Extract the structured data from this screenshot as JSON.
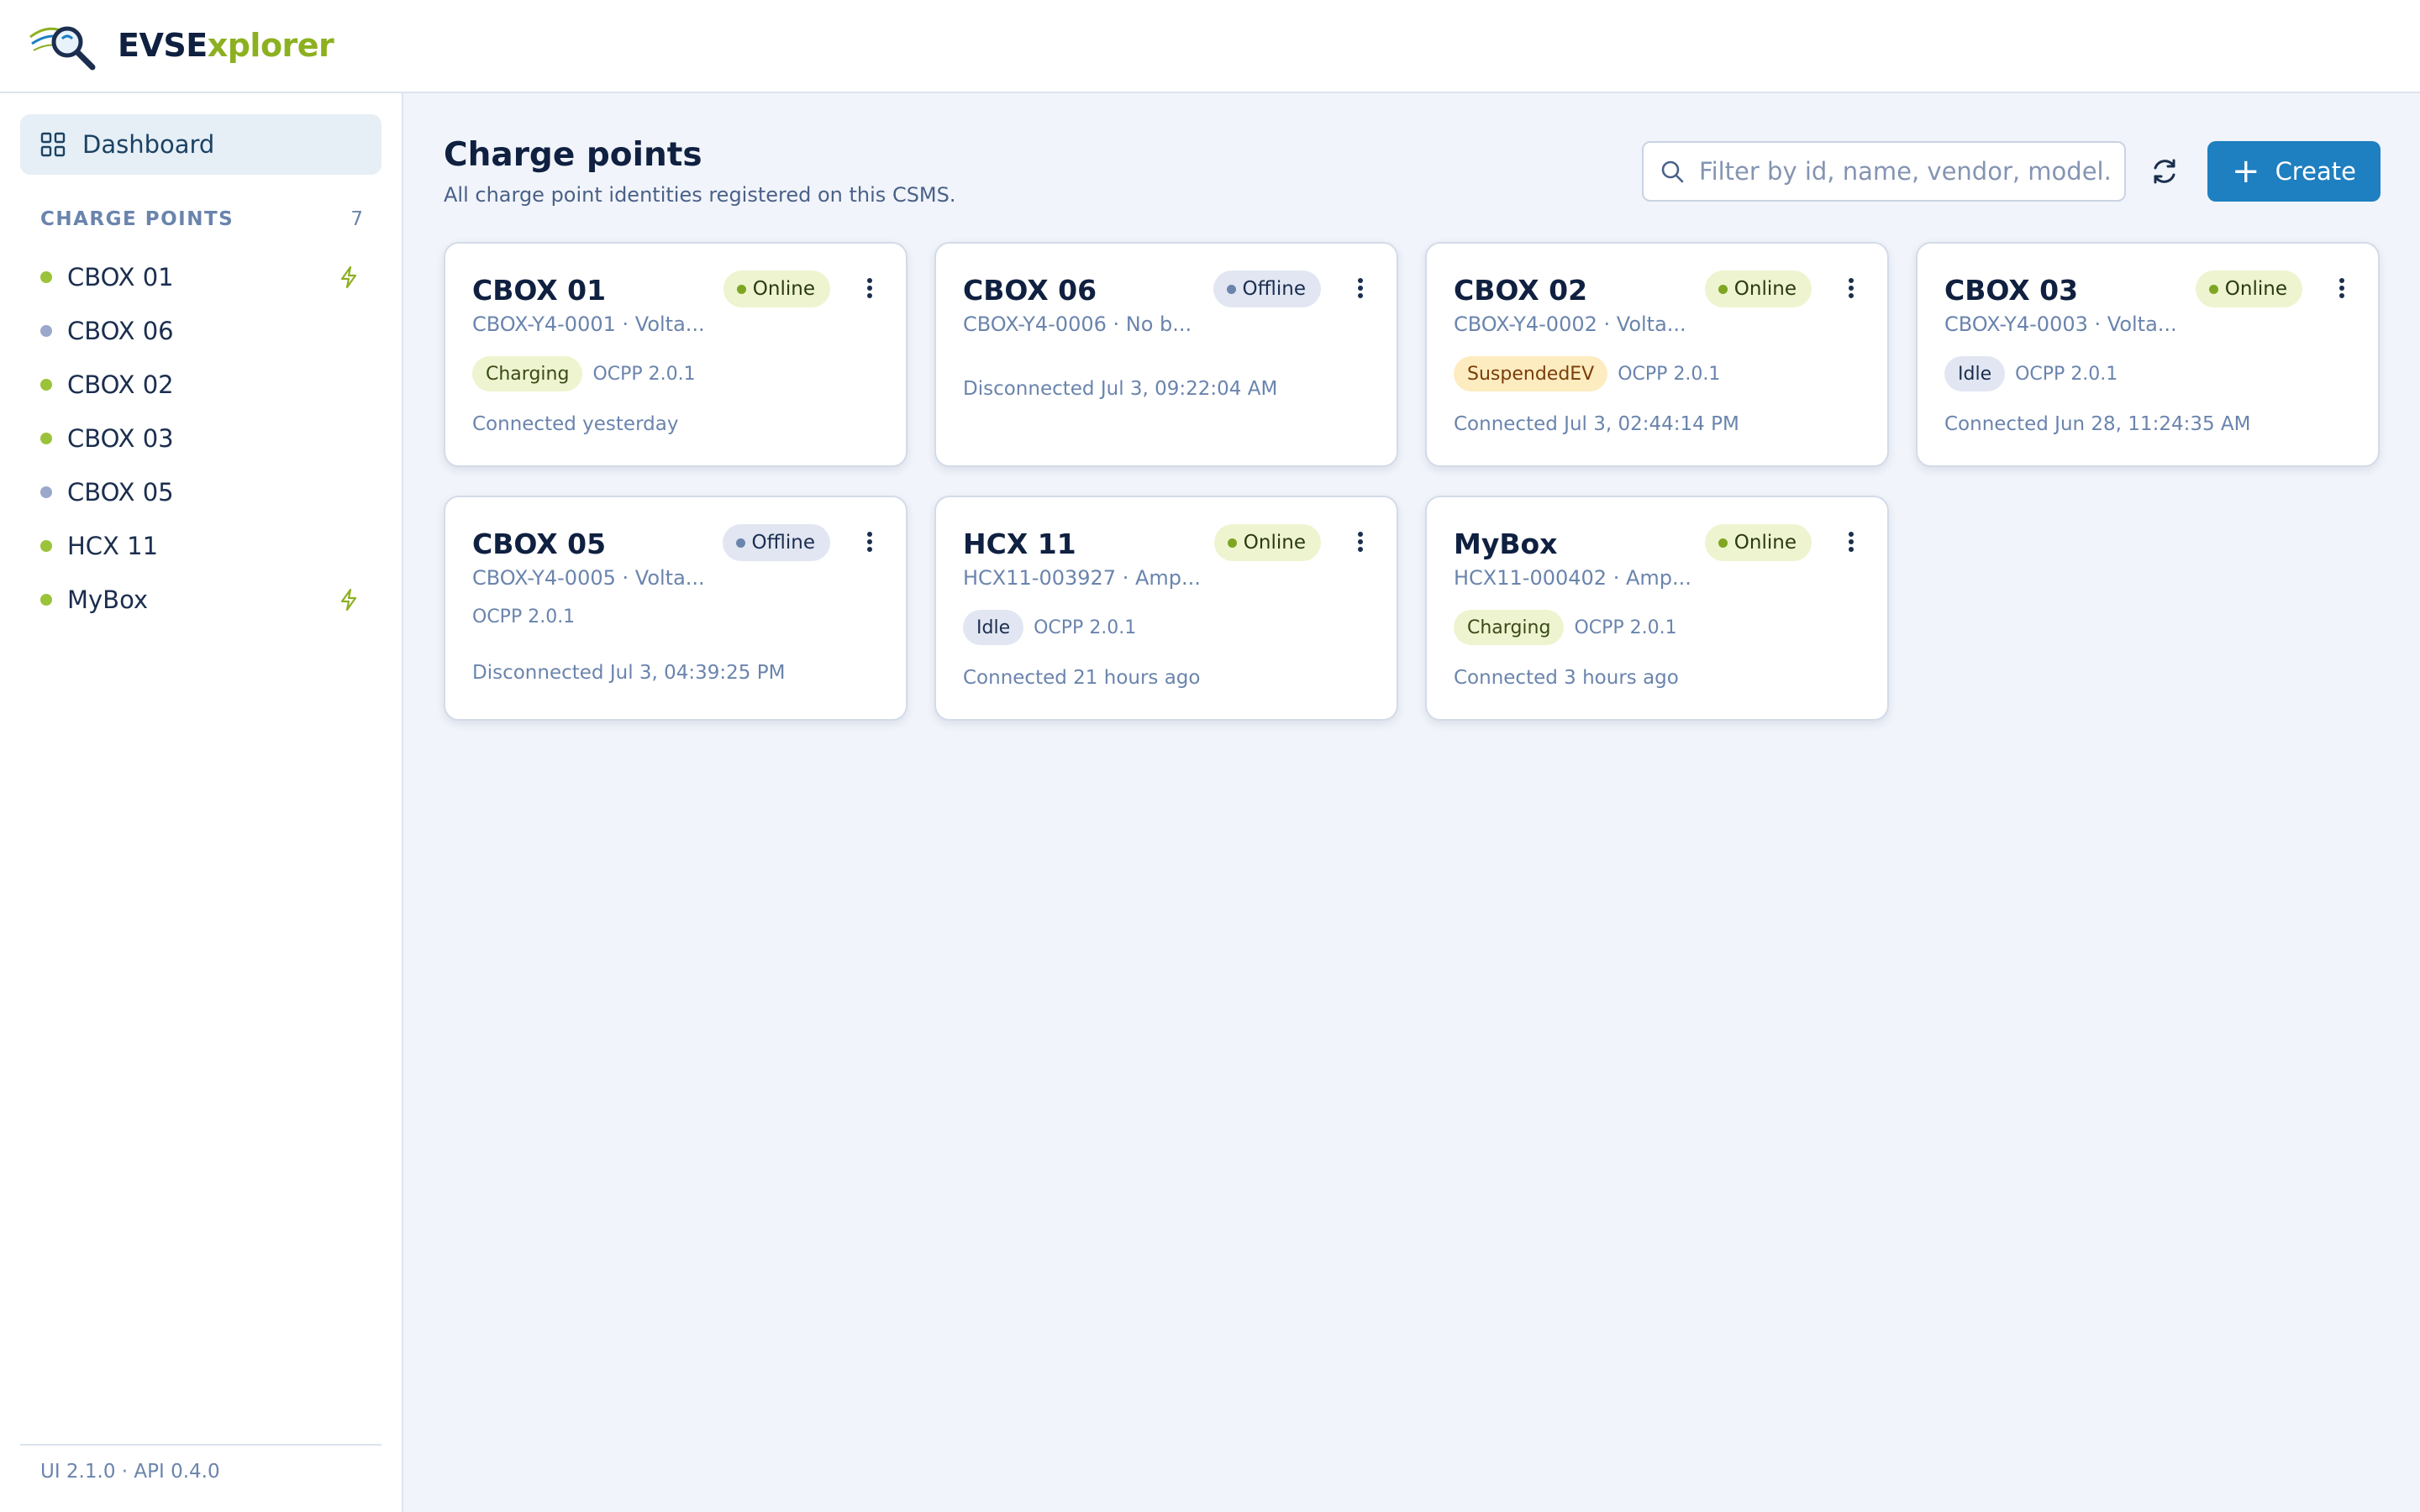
{
  "header": {
    "brand_prefix": "EVSE",
    "brand_suffix": "xplorer"
  },
  "sidebar": {
    "dashboard_label": "Dashboard",
    "section_title": "CHARGE POINTS",
    "section_count": "7",
    "items": [
      {
        "label": "CBOX 01",
        "status": "online",
        "charging": true
      },
      {
        "label": "CBOX 06",
        "status": "offline",
        "charging": false
      },
      {
        "label": "CBOX 02",
        "status": "online",
        "charging": false
      },
      {
        "label": "CBOX 03",
        "status": "online",
        "charging": false
      },
      {
        "label": "CBOX 05",
        "status": "offline",
        "charging": false
      },
      {
        "label": "HCX 11",
        "status": "online",
        "charging": false
      },
      {
        "label": "MyBox",
        "status": "online",
        "charging": true
      }
    ],
    "version": "UI 2.1.0 · API 0.4.0"
  },
  "main": {
    "title": "Charge points",
    "subtitle": "All charge point identities registered on this CSMS.",
    "search_placeholder": "Filter by id, name, vendor, model...",
    "create_label": "Create"
  },
  "cards": [
    {
      "name": "CBOX 01",
      "sub": "CBOX-Y4-0001 · Volta...",
      "status": "Online",
      "tag": "Charging",
      "ocpp": "OCPP 2.0.1",
      "connection": "Connected yesterday"
    },
    {
      "name": "CBOX 06",
      "sub": "CBOX-Y4-0006 · No b...",
      "status": "Offline",
      "tag": "",
      "ocpp": "",
      "connection": "Disconnected Jul 3, 09:22:04 AM"
    },
    {
      "name": "CBOX 02",
      "sub": "CBOX-Y4-0002 · Volta...",
      "status": "Online",
      "tag": "SuspendedEV",
      "ocpp": "OCPP 2.0.1",
      "connection": "Connected Jul 3, 02:44:14 PM"
    },
    {
      "name": "CBOX 03",
      "sub": "CBOX-Y4-0003 · Volta...",
      "status": "Online",
      "tag": "Idle",
      "ocpp": "OCPP 2.0.1",
      "connection": "Connected Jun 28, 11:24:35 AM"
    },
    {
      "name": "CBOX 05",
      "sub": "CBOX-Y4-0005 · Volta...",
      "status": "Offline",
      "tag": "",
      "ocpp": "OCPP 2.0.1",
      "connection": "Disconnected Jul 3, 04:39:25 PM"
    },
    {
      "name": "HCX 11",
      "sub": "HCX11-003927 · Amp...",
      "status": "Online",
      "tag": "Idle",
      "ocpp": "OCPP 2.0.1",
      "connection": "Connected 21 hours ago"
    },
    {
      "name": "MyBox",
      "sub": "HCX11-000402 · Amp...",
      "status": "Online",
      "tag": "Charging",
      "ocpp": "OCPP 2.0.1",
      "connection": "Connected 3 hours ago"
    }
  ],
  "colors": {
    "accent": "#1e7fc1",
    "brand_green": "#8db021",
    "online": "#9bc33a",
    "offline": "#9aa8cc"
  }
}
